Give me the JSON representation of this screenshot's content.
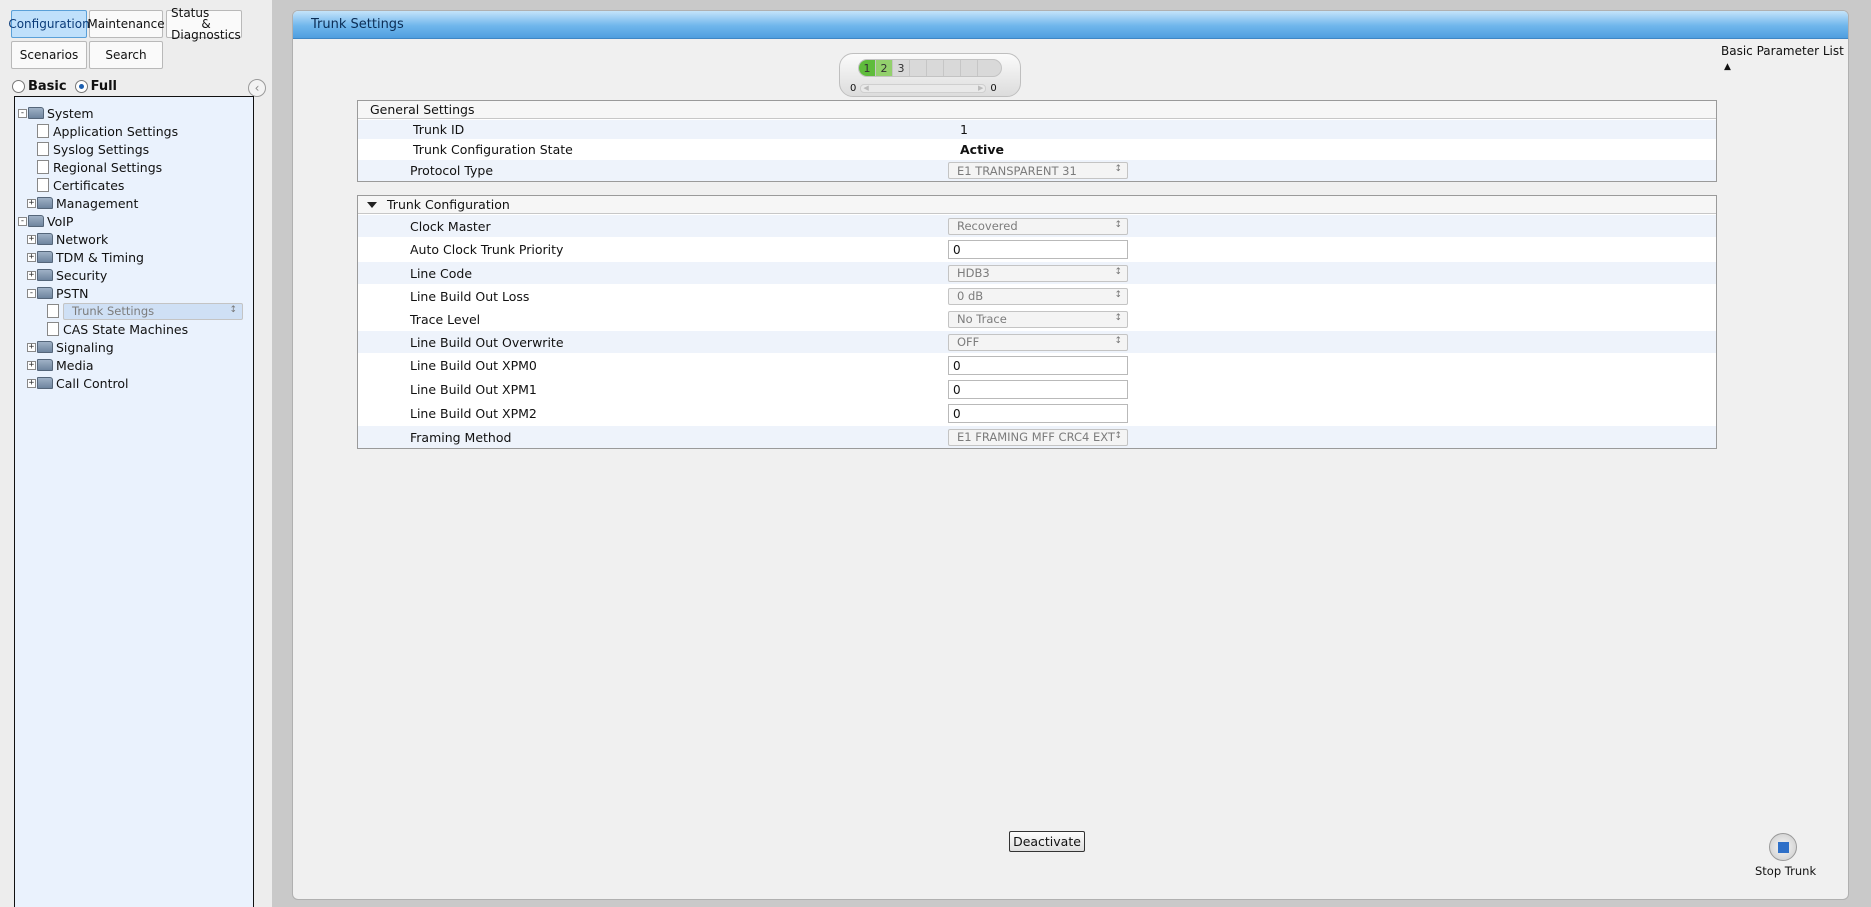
{
  "nav": {
    "configuration": "Configuration",
    "maintenance": "Maintenance",
    "status_line1": "Status",
    "status_line2": "& Diagnostics",
    "scenarios": "Scenarios",
    "search": "Search"
  },
  "mode": {
    "basic": "Basic",
    "full": "Full",
    "selected": "Full"
  },
  "tree": {
    "system": "System",
    "application_settings": "Application Settings",
    "syslog_settings": "Syslog Settings",
    "regional_settings": "Regional Settings",
    "certificates": "Certificates",
    "management": "Management",
    "voip": "VoIP",
    "network": "Network",
    "tdm_timing": "TDM & Timing",
    "security": "Security",
    "pstn": "PSTN",
    "trunk_settings": "Trunk Settings",
    "cas_state_machines": "CAS State Machines",
    "signaling": "Signaling",
    "media": "Media",
    "call_control": "Call Control"
  },
  "page": {
    "title": "Trunk Settings",
    "basic_parameter_list": "Basic Parameter List",
    "pager": {
      "pages": [
        "1",
        "2",
        "3"
      ],
      "left_count": "0",
      "right_count": "0"
    }
  },
  "general": {
    "header": "General Settings",
    "trunk_id_label": "Trunk ID",
    "trunk_id_value": "1",
    "state_label": "Trunk Configuration State",
    "state_value": "Active",
    "protocol_label": "Protocol Type",
    "protocol_value": "E1 TRANSPARENT 31"
  },
  "trunk_config": {
    "header": "Trunk Configuration",
    "rows": [
      {
        "label": "Clock Master",
        "value": "Recovered"
      },
      {
        "label": "Auto Clock Trunk Priority",
        "value": "0"
      },
      {
        "label": "Line Code",
        "value": "HDB3"
      },
      {
        "label": "Line Build Out Loss",
        "value": "0 dB"
      },
      {
        "label": "Trace Level",
        "value": "No Trace"
      },
      {
        "label": "Line Build Out Overwrite",
        "value": "OFF"
      },
      {
        "label": "Line Build Out XPM0",
        "value": "0"
      },
      {
        "label": "Line Build Out XPM1",
        "value": "0"
      },
      {
        "label": "Line Build Out XPM2",
        "value": "0"
      },
      {
        "label": "Framing Method",
        "value": "E1 FRAMING MFF CRC4 EXT"
      }
    ]
  },
  "actions": {
    "deactivate": "Deactivate",
    "stop_trunk": "Stop Trunk"
  },
  "colors": {
    "accent": "#4f9edf",
    "active_green": "#5fbc3c"
  }
}
